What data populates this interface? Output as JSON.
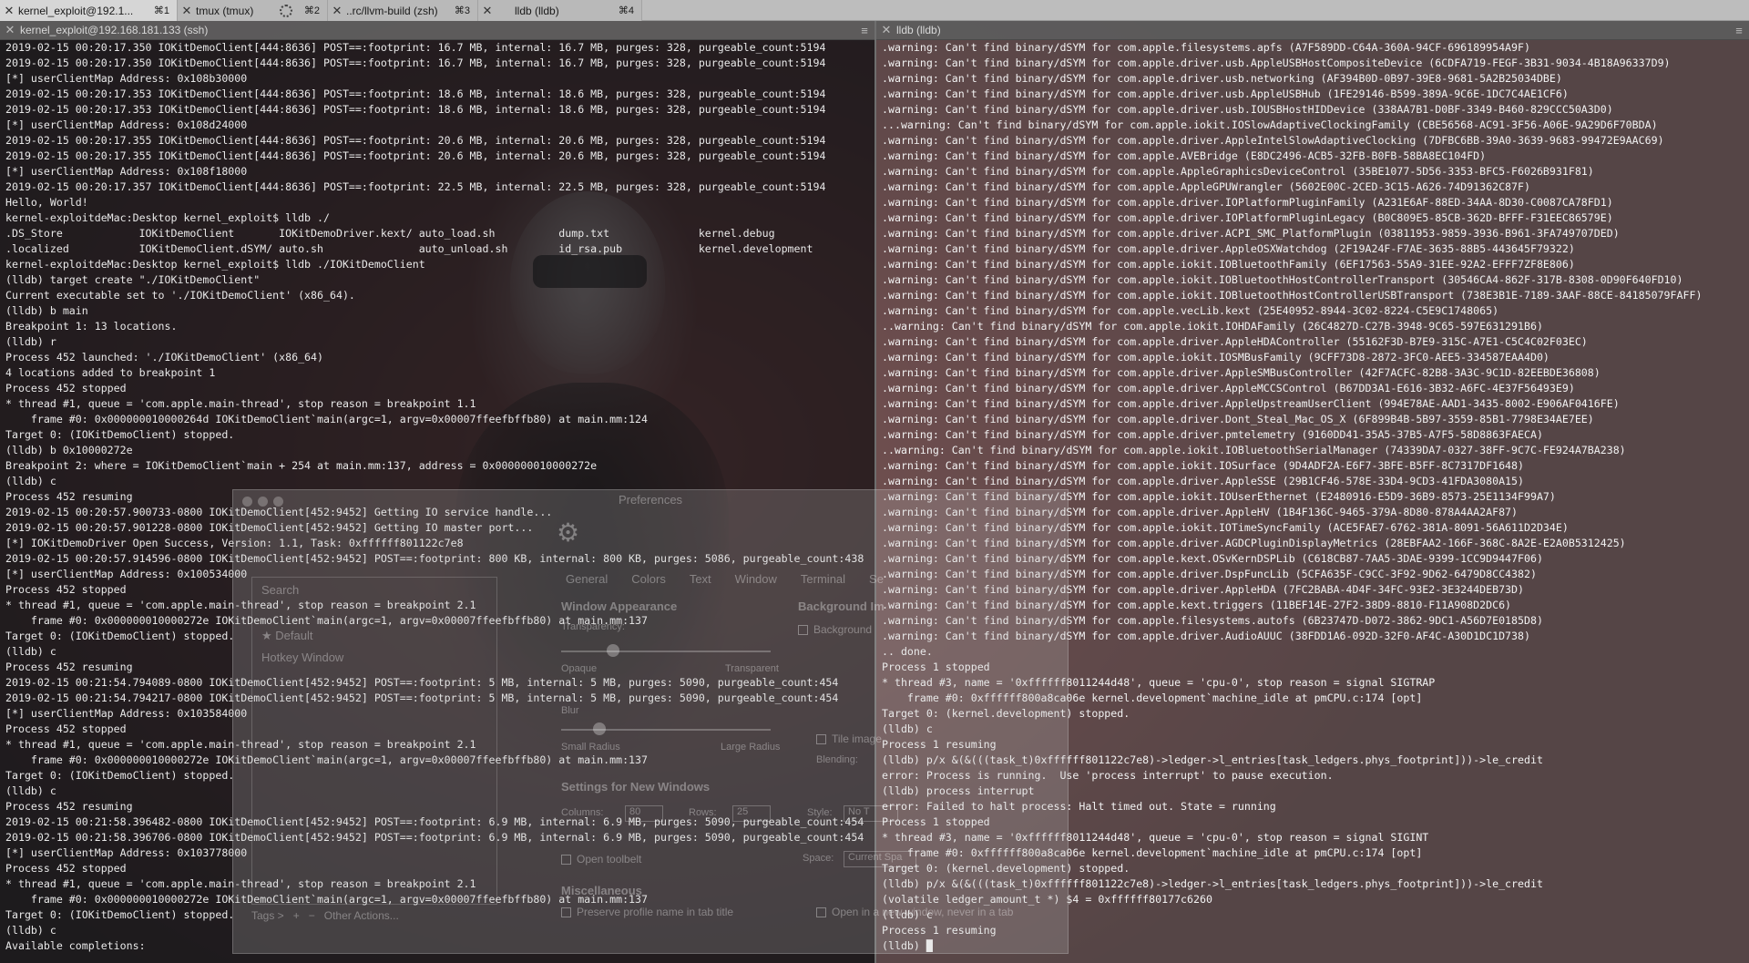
{
  "tabs": [
    {
      "label": "kernel_exploit@192.1...",
      "num": "⌘1",
      "active": true
    },
    {
      "label": "tmux (tmux)",
      "num": "⌘2",
      "active": false,
      "spinner": true
    },
    {
      "label": "..rc/llvm-build (zsh)",
      "num": "⌘3",
      "active": false
    },
    {
      "label": "lldb (lldb)",
      "num": "⌘4",
      "active": false
    }
  ],
  "left_pane": {
    "title": "kernel_exploit@192.168.181.133 (ssh)",
    "lines": [
      "2019-02-15 00:20:17.350 IOKitDemoClient[444:8636] POST==:footprint: 16.7 MB, internal: 16.7 MB, purges: 328, purgeable_count:5194",
      "2019-02-15 00:20:17.350 IOKitDemoClient[444:8636] POST==:footprint: 16.7 MB, internal: 16.7 MB, purges: 328, purgeable_count:5194",
      "[*] userClientMap Address: 0x108b30000",
      "2019-02-15 00:20:17.353 IOKitDemoClient[444:8636] POST==:footprint: 18.6 MB, internal: 18.6 MB, purges: 328, purgeable_count:5194",
      "2019-02-15 00:20:17.353 IOKitDemoClient[444:8636] POST==:footprint: 18.6 MB, internal: 18.6 MB, purges: 328, purgeable_count:5194",
      "[*] userClientMap Address: 0x108d24000",
      "2019-02-15 00:20:17.355 IOKitDemoClient[444:8636] POST==:footprint: 20.6 MB, internal: 20.6 MB, purges: 328, purgeable_count:5194",
      "2019-02-15 00:20:17.355 IOKitDemoClient[444:8636] POST==:footprint: 20.6 MB, internal: 20.6 MB, purges: 328, purgeable_count:5194",
      "[*] userClientMap Address: 0x108f18000",
      "2019-02-15 00:20:17.357 IOKitDemoClient[444:8636] POST==:footprint: 22.5 MB, internal: 22.5 MB, purges: 328, purgeable_count:5194",
      "Hello, World!",
      "kernel-exploitdeMac:Desktop kernel_exploit$ lldb ./",
      ".DS_Store            IOKitDemoClient       IOKitDemoDriver.kext/ auto_load.sh          dump.txt              kernel.debug",
      ".localized           IOKitDemoClient.dSYM/ auto.sh               auto_unload.sh        id_rsa.pub            kernel.development",
      "kernel-exploitdeMac:Desktop kernel_exploit$ lldb ./IOKitDemoClient",
      "(lldb) target create \"./IOKitDemoClient\"",
      "Current executable set to './IOKitDemoClient' (x86_64).",
      "(lldb) b main",
      "Breakpoint 1: 13 locations.",
      "(lldb) r",
      "Process 452 launched: './IOKitDemoClient' (x86_64)",
      "4 locations added to breakpoint 1",
      "Process 452 stopped",
      "* thread #1, queue = 'com.apple.main-thread', stop reason = breakpoint 1.1",
      "    frame #0: 0x000000010000264d IOKitDemoClient`main(argc=1, argv=0x00007ffeefbffb80) at main.mm:124",
      "Target 0: (IOKitDemoClient) stopped.",
      "(lldb) b 0x10000272e",
      "Breakpoint 2: where = IOKitDemoClient`main + 254 at main.mm:137, address = 0x000000010000272e",
      "(lldb) c",
      "Process 452 resuming",
      "2019-02-15 00:20:57.900733-0800 IOKitDemoClient[452:9452] Getting IO service handle...",
      "2019-02-15 00:20:57.901228-0800 IOKitDemoClient[452:9452] Getting IO master port...",
      "[*] IOKitDemoDriver Open Success, Version: 1.1, Task: 0xffffff801122c7e8",
      "2019-02-15 00:20:57.914596-0800 IOKitDemoClient[452:9452] POST==:footprint: 800 KB, internal: 800 KB, purges: 5086, purgeable_count:438",
      "[*] userClientMap Address: 0x100534000",
      "Process 452 stopped",
      "* thread #1, queue = 'com.apple.main-thread', stop reason = breakpoint 2.1",
      "    frame #0: 0x000000010000272e IOKitDemoClient`main(argc=1, argv=0x00007ffeefbffb80) at main.mm:137",
      "Target 0: (IOKitDemoClient) stopped.",
      "(lldb) c",
      "Process 452 resuming",
      "2019-02-15 00:21:54.794089-0800 IOKitDemoClient[452:9452] POST==:footprint: 5 MB, internal: 5 MB, purges: 5090, purgeable_count:454",
      "2019-02-15 00:21:54.794217-0800 IOKitDemoClient[452:9452] POST==:footprint: 5 MB, internal: 5 MB, purges: 5090, purgeable_count:454",
      "[*] userClientMap Address: 0x103584000",
      "Process 452 stopped",
      "* thread #1, queue = 'com.apple.main-thread', stop reason = breakpoint 2.1",
      "    frame #0: 0x000000010000272e IOKitDemoClient`main(argc=1, argv=0x00007ffeefbffb80) at main.mm:137",
      "Target 0: (IOKitDemoClient) stopped.",
      "(lldb) c",
      "Process 452 resuming",
      "2019-02-15 00:21:58.396482-0800 IOKitDemoClient[452:9452] POST==:footprint: 6.9 MB, internal: 6.9 MB, purges: 5090, purgeable_count:454",
      "2019-02-15 00:21:58.396706-0800 IOKitDemoClient[452:9452] POST==:footprint: 6.9 MB, internal: 6.9 MB, purges: 5090, purgeable_count:454",
      "[*] userClientMap Address: 0x103778000",
      "Process 452 stopped",
      "* thread #1, queue = 'com.apple.main-thread', stop reason = breakpoint 2.1",
      "    frame #0: 0x000000010000272e IOKitDemoClient`main(argc=1, argv=0x00007ffeefbffb80) at main.mm:137",
      "Target 0: (IOKitDemoClient) stopped.",
      "(lldb) c",
      "Available completions:"
    ]
  },
  "right_pane": {
    "title": "lldb (lldb)",
    "lines": [
      ".warning: Can't find binary/dSYM for com.apple.filesystems.apfs (A7F589DD-C64A-360A-94CF-696189954A9F)",
      ".warning: Can't find binary/dSYM for com.apple.driver.usb.AppleUSBHostCompositeDevice (6CDFA719-FEGF-3B31-9034-4B18A96337D9)",
      ".warning: Can't find binary/dSYM for com.apple.driver.usb.networking (AF394B0D-0B97-39E8-9681-5A2B25034DBE)",
      ".warning: Can't find binary/dSYM for com.apple.driver.usb.AppleUSBHub (1FE29146-B599-389A-9C6E-1DC7C4AE1CF6)",
      ".warning: Can't find binary/dSYM for com.apple.driver.usb.IOUSBHostHIDDevice (338AA7B1-D0BF-3349-B460-829CCC50A3D0)",
      "...warning: Can't find binary/dSYM for com.apple.iokit.IOSlowAdaptiveClockingFamily (CBE56568-AC91-3F56-A06E-9A29D6F70BDA)",
      ".warning: Can't find binary/dSYM for com.apple.driver.AppleIntelSlowAdaptiveClocking (7DFBC6BB-39A0-3639-9683-99472E9AAC69)",
      ".warning: Can't find binary/dSYM for com.apple.AVEBridge (E8DC2496-ACB5-32FB-B0FB-58BA8EC104FD)",
      ".warning: Can't find binary/dSYM for com.apple.AppleGraphicsDeviceControl (35BE1077-5D56-3353-BFC5-F6026B931F81)",
      ".warning: Can't find binary/dSYM for com.apple.AppleGPUWrangler (5602E00C-2CED-3C15-A626-74D91362C87F)",
      ".warning: Can't find binary/dSYM for com.apple.driver.IOPlatformPluginFamily (A231E6AF-88ED-34AA-8D30-C0087CA78FD1)",
      ".warning: Can't find binary/dSYM for com.apple.driver.IOPlatformPluginLegacy (B0C809E5-85CB-362D-BFFF-F31EEC86579E)",
      ".warning: Can't find binary/dSYM for com.apple.driver.ACPI_SMC_PlatformPlugin (03811953-9859-3936-B961-3FA749707DED)",
      ".warning: Can't find binary/dSYM for com.apple.driver.AppleOSXWatchdog (2F19A24F-F7AE-3635-88B5-443645F79322)",
      ".warning: Can't find binary/dSYM for com.apple.iokit.IOBluetoothFamily (6EF17563-55A9-31EE-92A2-EFFF7ZF8E806)",
      ".warning: Can't find binary/dSYM for com.apple.iokit.IOBluetoothHostControllerTransport (30546CA4-862F-317B-8308-0D90F640FD10)",
      ".warning: Can't find binary/dSYM for com.apple.iokit.IOBluetoothHostControllerUSBTransport (738E3B1E-7189-3AAF-88CE-84185079FAFF)",
      ".warning: Can't find binary/dSYM for com.apple.vecLib.kext (25E40952-8944-3C02-8224-C5E9C1748065)",
      "..warning: Can't find binary/dSYM for com.apple.iokit.IOHDAFamily (26C4827D-C27B-3948-9C65-597E631291B6)",
      ".warning: Can't find binary/dSYM for com.apple.driver.AppleHDAController (55162F3D-B7E9-315C-A7E1-C5C4C02F03EC)",
      ".warning: Can't find binary/dSYM for com.apple.iokit.IOSMBusFamily (9CFF73D8-2872-3FC0-AEE5-334587EAA4D0)",
      ".warning: Can't find binary/dSYM for com.apple.driver.AppleSMBusController (42F7ACFC-82B8-3A3C-9C1D-82EEBDE36808)",
      ".warning: Can't find binary/dSYM for com.apple.driver.AppleMCCSControl (B67DD3A1-E616-3B32-A6FC-4E37F56493E9)",
      ".warning: Can't find binary/dSYM for com.apple.driver.AppleUpstreamUserClient (994E78AE-AAD1-3435-8002-E906AF0416FE)",
      ".warning: Can't find binary/dSYM for com.apple.driver.Dont_Steal_Mac_OS_X (6F899B4B-5B97-3559-85B1-7798E34AE7EE)",
      ".warning: Can't find binary/dSYM for com.apple.driver.pmtelemetry (9160DD41-35A5-37B5-A7F5-58D8863FAECA)",
      "..warning: Can't find binary/dSYM for com.apple.iokit.IOBluetoothSerialManager (74339DA7-0327-38FF-9C7C-FE924A7BA238)",
      ".warning: Can't find binary/dSYM for com.apple.iokit.IOSurface (9D4ADF2A-E6F7-3BFE-B5FF-8C7317DF1648)",
      ".warning: Can't find binary/dSYM for com.apple.driver.AppleSSE (29B1CF46-578E-33D4-9CD3-41FDA3080A15)",
      ".warning: Can't find binary/dSYM for com.apple.iokit.IOUserEthernet (E2480916-E5D9-36B9-8573-25E1134F99A7)",
      ".warning: Can't find binary/dSYM for com.apple.driver.AppleHV (1B4F136C-9465-379A-8D80-878A4AA2AF87)",
      ".warning: Can't find binary/dSYM for com.apple.iokit.IOTimeSyncFamily (ACE5FAE7-6762-381A-8091-56A611D2D34E)",
      ".warning: Can't find binary/dSYM for com.apple.driver.AGDCPluginDisplayMetrics (28EBFAA2-166F-368C-8A2E-E2A0B5312425)",
      ".warning: Can't find binary/dSYM for com.apple.kext.OSvKernDSPLib (C618CB87-7AA5-3DAE-9399-1CC9D9447F06)",
      ".warning: Can't find binary/dSYM for com.apple.driver.DspFuncLib (5CFA635F-C9CC-3F92-9D62-6479D8CC4382)",
      ".warning: Can't find binary/dSYM for com.apple.driver.AppleHDA (7FC2BABA-4D4F-34FC-93E2-3E3244DEB73D)",
      ".warning: Can't find binary/dSYM for com.apple.kext.triggers (11BEF14E-27F2-38D9-8810-F11A908D2DC6)",
      ".warning: Can't find binary/dSYM for com.apple.filesystems.autofs (6B23747D-D072-3862-9DC1-A56D7E0185D8)",
      ".warning: Can't find binary/dSYM for com.apple.driver.AudioAUUC (38FDD1A6-092D-32F0-AF4C-A30D1DC1D738)",
      ".. done.",
      "Process 1 stopped",
      "* thread #3, name = '0xffffff8011244d48', queue = 'cpu-0', stop reason = signal SIGTRAP",
      "    frame #0: 0xffffff800a8ca06e kernel.development`machine_idle at pmCPU.c:174 [opt]",
      "Target 0: (kernel.development) stopped.",
      "(lldb) c",
      "Process 1 resuming",
      "(lldb) p/x &(&(((task_t)0xffffff801122c7e8)->ledger->l_entries[task_ledgers.phys_footprint]))->le_credit",
      "error: Process is running.  Use 'process interrupt' to pause execution.",
      "(lldb) process interrupt",
      "error: Failed to halt process: Halt timed out. State = running",
      "Process 1 stopped",
      "* thread #3, name = '0xffffff8011244d48', queue = 'cpu-0', stop reason = signal SIGINT",
      "    frame #0: 0xffffff800a8ca06e kernel.development`machine_idle at pmCPU.c:174 [opt]",
      "Target 0: (kernel.development) stopped.",
      "(lldb) p/x &(&(((task_t)0xffffff801122c7e8)->ledger->l_entries[task_ledgers.phys_footprint]))->le_credit",
      "(volatile ledger_amount_t *) $4 = 0xffffff80177c6260",
      "(lldb) c",
      "Process 1 resuming",
      "(lldb) █"
    ]
  },
  "prefs_ghost": {
    "title": "Preferences",
    "search": "Search",
    "profiles": [
      "★ Default",
      "Hotkey Window"
    ],
    "tabs": [
      "General",
      "Colors",
      "Text",
      "Window",
      "Terminal",
      "Se"
    ],
    "window_appearance": "Window Appearance",
    "transparency": "Transparency:",
    "opaque": "Opaque",
    "transparent": "Transparent",
    "blur": "Blur",
    "small_radius": "Small Radius",
    "large_radius": "Large Radius",
    "background_image": "Background Im",
    "background_check": "Background",
    "tile_image": "Tile image",
    "blending": "Blending:",
    "settings_new": "Settings for New Windows",
    "columns_label": "Columns:",
    "columns_value": "80",
    "rows_label": "Rows:",
    "rows_value": "25",
    "style_label": "Style:",
    "style_value": "No T",
    "space_label": "Space:",
    "space_value": "Current Spa",
    "open_toolbelt": "Open toolbelt",
    "misc": "Miscellaneous",
    "preserve": "Preserve profile name in tab title",
    "open_new": "Open in a new window, never in a tab",
    "tags": "Tags >",
    "other_actions": "Other Actions..."
  }
}
